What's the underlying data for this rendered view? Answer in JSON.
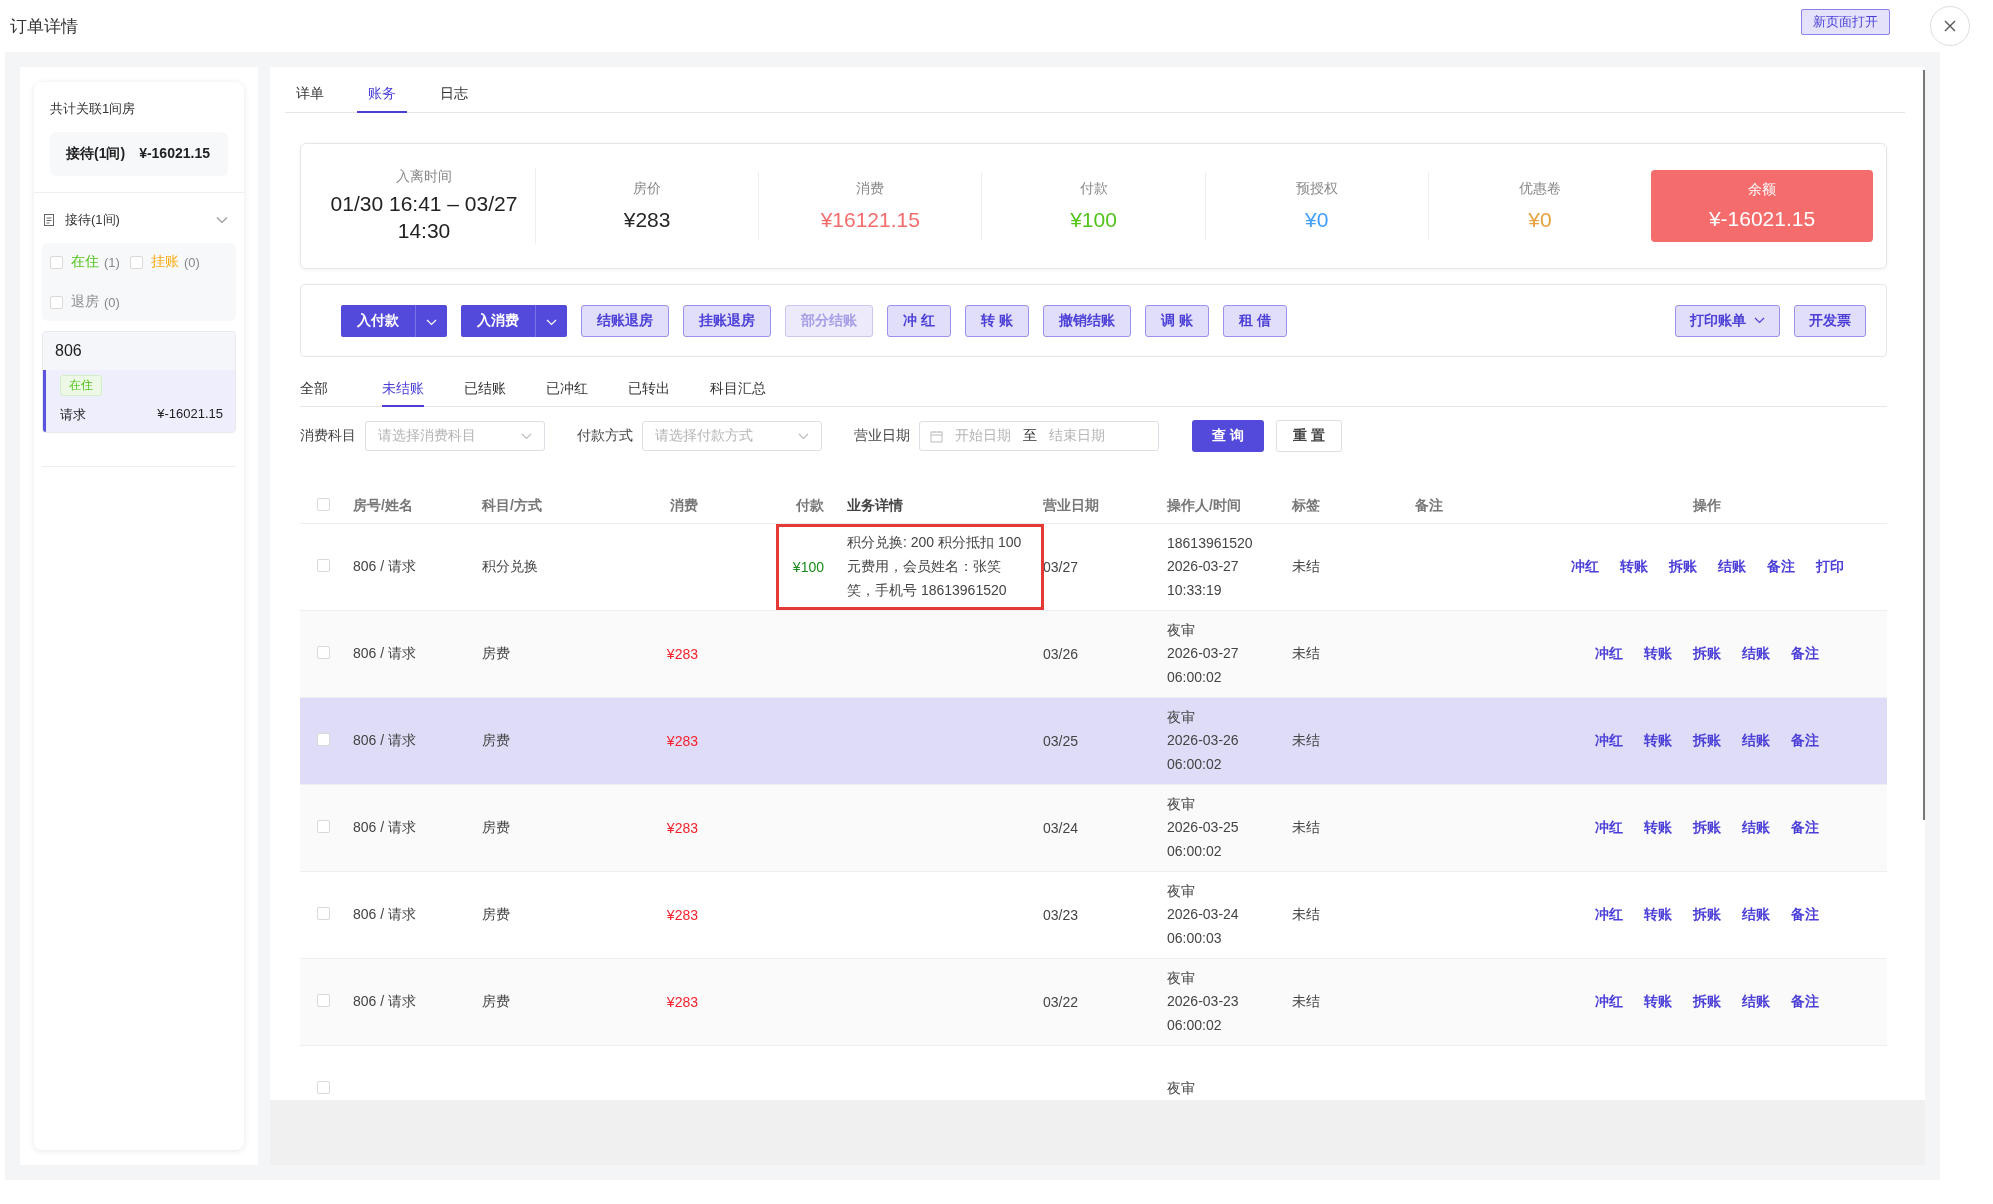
{
  "window": {
    "title": "订单详情",
    "open_button": "新页面打开"
  },
  "sidebar": {
    "title": "共计关联1间房",
    "summary": {
      "label": "接待(1间)",
      "amount": "¥-16021.15"
    },
    "group": {
      "label": "接待(1间)",
      "expanded": true,
      "filters": [
        {
          "label": "在住",
          "count": "(1)",
          "checked": false,
          "color": "#52c41a"
        },
        {
          "label": "挂账",
          "count": "(0)",
          "checked": false,
          "color": "#faad14"
        },
        {
          "label": "退房",
          "count": "(0)",
          "checked": false,
          "color": "#8c8c8c"
        }
      ],
      "rooms": [
        {
          "room": "806",
          "status": "在住",
          "guest": "请求",
          "amount": "¥-16021.15",
          "selected": true
        }
      ]
    }
  },
  "tabs": [
    {
      "label": "详单",
      "selected": false
    },
    {
      "label": "账务",
      "selected": true
    },
    {
      "label": "日志",
      "selected": false
    }
  ],
  "summary": [
    {
      "kind": "stay",
      "label": "入离时间",
      "value": "01/30 16:41 – 03/27 14:30"
    },
    {
      "kind": "stat",
      "label": "房价",
      "value": "¥283",
      "color": "#262626"
    },
    {
      "kind": "stat",
      "label": "消费",
      "value": "¥16121.15",
      "color": "#f56c6c"
    },
    {
      "kind": "stat",
      "label": "付款",
      "value": "¥100",
      "color": "#52c41a"
    },
    {
      "kind": "stat",
      "label": "预授权",
      "value": "¥0",
      "color": "#409eff"
    },
    {
      "kind": "stat",
      "label": "优惠卷",
      "value": "¥0",
      "color": "#e6a23c"
    },
    {
      "kind": "balance",
      "label": "余额",
      "value": "¥-16021.15",
      "color": "#f56c6c"
    }
  ],
  "actions": [
    {
      "kind": "split",
      "label": "入付款"
    },
    {
      "kind": "split",
      "label": "入消费"
    },
    {
      "kind": "plain",
      "label": "结账退房",
      "disabled": false
    },
    {
      "kind": "plain",
      "label": "挂账退房",
      "disabled": false
    },
    {
      "kind": "plain",
      "label": "部分结账",
      "disabled": true
    },
    {
      "kind": "plain",
      "label": "冲 红",
      "disabled": false
    },
    {
      "kind": "plain",
      "label": "转 账",
      "disabled": false
    },
    {
      "kind": "plain",
      "label": "撤销结账",
      "disabled": false
    },
    {
      "kind": "plain",
      "label": "调 账",
      "disabled": false
    },
    {
      "kind": "plain",
      "label": "租 借",
      "disabled": false
    }
  ],
  "right_actions": [
    {
      "kind": "dropdown",
      "label": "打印账单"
    },
    {
      "kind": "plain",
      "label": "开发票"
    }
  ],
  "sub_tabs": [
    {
      "label": "全部",
      "selected": false
    },
    {
      "label": "未结账",
      "selected": true
    },
    {
      "label": "已结账",
      "selected": false
    },
    {
      "label": "已冲红",
      "selected": false
    },
    {
      "label": "已转出",
      "selected": false
    },
    {
      "label": "科目汇总",
      "selected": false
    }
  ],
  "filters": {
    "subject": {
      "label": "消费科目",
      "placeholder": "请选择消费科目"
    },
    "payment": {
      "label": "付款方式",
      "placeholder": "请选择付款方式"
    },
    "date": {
      "label": "营业日期",
      "start_placeholder": "开始日期",
      "separator": "至",
      "end_placeholder": "结束日期"
    },
    "search_button": "查 询",
    "reset_button": "重 置"
  },
  "table": {
    "header_checked": false,
    "columns": [
      "房号/姓名",
      "科目/方式",
      "消费",
      "付款",
      "业务详情",
      "营业日期",
      "操作人/时间",
      "标签",
      "备注",
      "操作"
    ],
    "rows": [
      {
        "room": "806 / 请求",
        "subject": "积分兑换",
        "payment": "¥100",
        "detail": "积分兑换: 200 积分抵扣 100 元费用，会员姓名：张笑笑，手机号 18613961520",
        "date": "03/27",
        "operator": "18613961520",
        "time": "2026-03-27 10:33:19",
        "tag": "未结",
        "checked": false,
        "highlighted": false,
        "boxed": true,
        "ops": [
          "冲红",
          "转账",
          "拆账",
          "结账",
          "备注",
          "打印"
        ]
      },
      {
        "room": "806 / 请求",
        "subject": "房费",
        "consume": "¥283",
        "date": "03/26",
        "operator": "夜审",
        "time": "2026-03-27 06:00:02",
        "tag": "未结",
        "checked": false,
        "highlighted": false,
        "boxed": false,
        "ops": [
          "冲红",
          "转账",
          "拆账",
          "结账",
          "备注"
        ]
      },
      {
        "room": "806 / 请求",
        "subject": "房费",
        "consume": "¥283",
        "date": "03/25",
        "operator": "夜审",
        "time": "2026-03-26 06:00:02",
        "tag": "未结",
        "checked": false,
        "highlighted": true,
        "boxed": false,
        "ops": [
          "冲红",
          "转账",
          "拆账",
          "结账",
          "备注"
        ]
      },
      {
        "room": "806 / 请求",
        "subject": "房费",
        "consume": "¥283",
        "date": "03/24",
        "operator": "夜审",
        "time": "2026-03-25 06:00:02",
        "tag": "未结",
        "checked": false,
        "highlighted": false,
        "boxed": false,
        "ops": [
          "冲红",
          "转账",
          "拆账",
          "结账",
          "备注"
        ]
      },
      {
        "room": "806 / 请求",
        "subject": "房费",
        "consume": "¥283",
        "date": "03/23",
        "operator": "夜审",
        "time": "2026-03-24 06:00:03",
        "tag": "未结",
        "checked": false,
        "highlighted": false,
        "boxed": false,
        "ops": [
          "冲红",
          "转账",
          "拆账",
          "结账",
          "备注"
        ]
      },
      {
        "room": "806 / 请求",
        "subject": "房费",
        "consume": "¥283",
        "date": "03/22",
        "operator": "夜审",
        "time": "2026-03-23 06:00:02",
        "tag": "未结",
        "checked": false,
        "highlighted": false,
        "boxed": false,
        "ops": [
          "冲红",
          "转账",
          "拆账",
          "结账",
          "备注"
        ]
      },
      {
        "operator": "夜审",
        "checked": false,
        "highlighted": false,
        "boxed": false
      }
    ]
  }
}
